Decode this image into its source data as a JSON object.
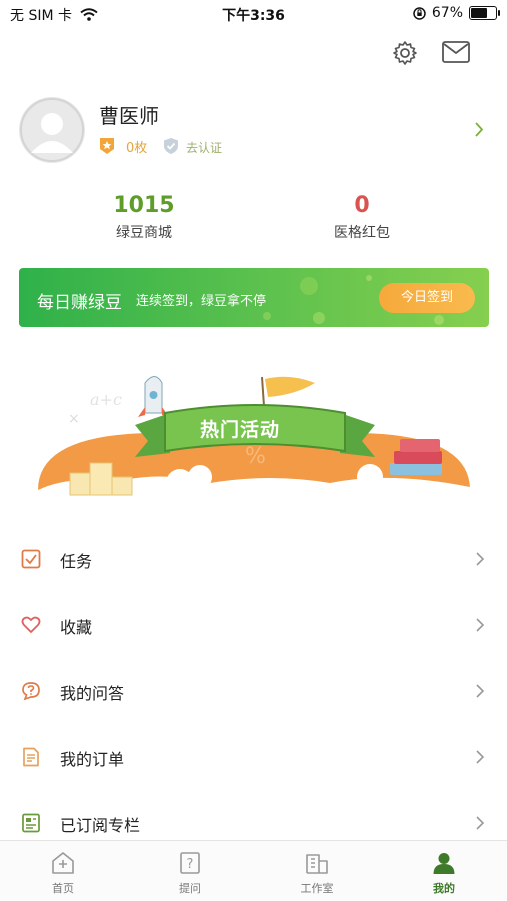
{
  "status_bar": {
    "carrier": "无 SIM 卡",
    "time": "下午3:36",
    "battery": "67%"
  },
  "profile": {
    "name": "曹医师",
    "medal_count": "0枚",
    "verify_label": "去认证"
  },
  "stats": [
    {
      "value": "1015",
      "label": "绿豆商城",
      "color": "#5f9d2a"
    },
    {
      "value": "0",
      "label": "医格红包",
      "color": "#d9534f"
    }
  ],
  "banner": {
    "title": "每日赚绿豆",
    "subtitle": "连续签到，绿豆拿不停",
    "button": "今日签到"
  },
  "activity": {
    "title": "热门活动"
  },
  "menu": [
    {
      "label": "任务",
      "icon": "task-icon"
    },
    {
      "label": "收藏",
      "icon": "heart-icon"
    },
    {
      "label": "我的问答",
      "icon": "qa-icon"
    },
    {
      "label": "我的订单",
      "icon": "order-icon"
    },
    {
      "label": "已订阅专栏",
      "icon": "column-icon"
    }
  ],
  "tabs": [
    {
      "label": "首页",
      "icon": "home-icon"
    },
    {
      "label": "提问",
      "icon": "question-icon"
    },
    {
      "label": "工作室",
      "icon": "studio-icon"
    },
    {
      "label": "我的",
      "icon": "profile-icon"
    }
  ],
  "colors": {
    "accent_green": "#5f9d2a",
    "menu_icon": "#e07a47",
    "tab_active": "#3f7a2a"
  }
}
